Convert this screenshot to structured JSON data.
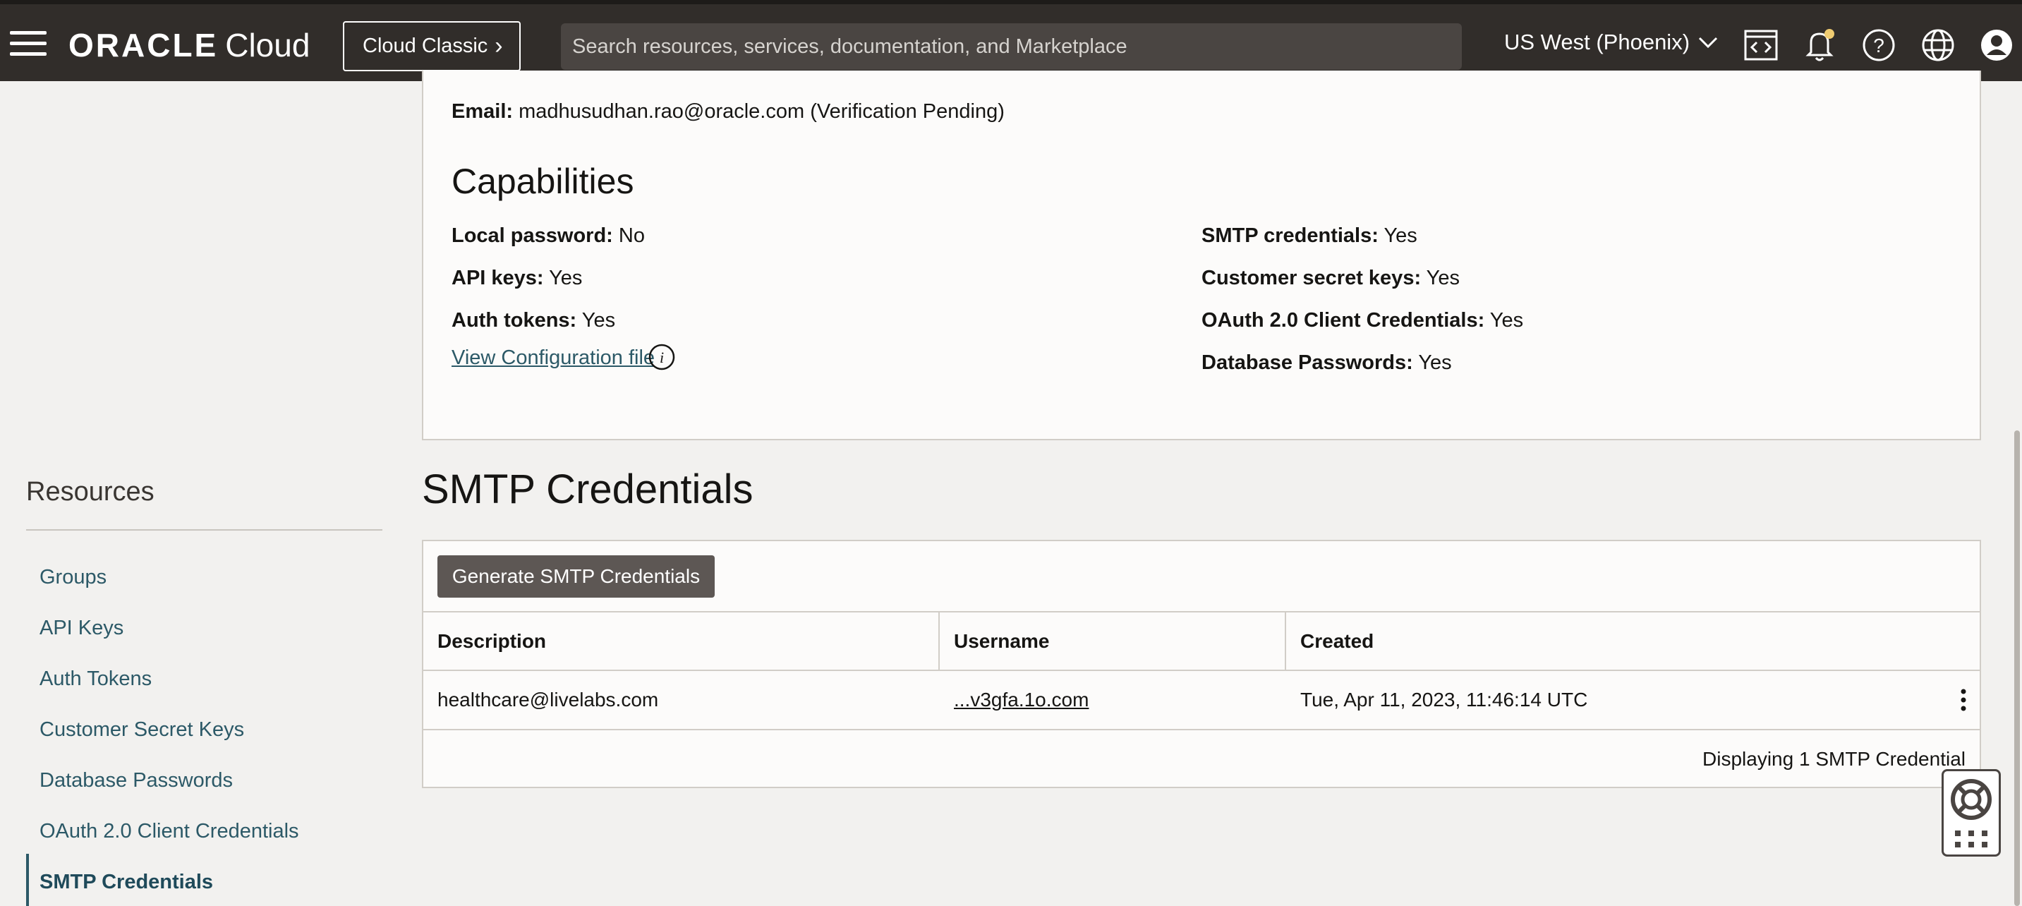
{
  "topbar": {
    "brand_oracle": "ORACLE",
    "brand_cloud": "Cloud",
    "classic_label": "Cloud Classic",
    "search_placeholder": "Search resources, services, documentation, and Marketplace",
    "region": "US West (Phoenix)",
    "icons": [
      "menu-icon",
      "code-editor-icon",
      "bell-icon",
      "help-icon",
      "globe-icon",
      "user-icon"
    ]
  },
  "user": {
    "email_label": "Email:",
    "email_value": "madhusudhan.rao@oracle.com (Verification Pending)"
  },
  "capabilities": {
    "title": "Capabilities",
    "left": [
      {
        "label": "Local password:",
        "value": "No"
      },
      {
        "label": "API keys:",
        "value": "Yes"
      },
      {
        "label": "Auth tokens:",
        "value": "Yes"
      }
    ],
    "right": [
      {
        "label": "SMTP credentials:",
        "value": "Yes"
      },
      {
        "label": "Customer secret keys:",
        "value": "Yes"
      },
      {
        "label": "OAuth 2.0 Client Credentials:",
        "value": "Yes"
      },
      {
        "label": "Database Passwords:",
        "value": "Yes"
      }
    ],
    "config_link": "View Configuration file"
  },
  "resources": {
    "title": "Resources",
    "items": [
      {
        "label": "Groups"
      },
      {
        "label": "API Keys"
      },
      {
        "label": "Auth Tokens"
      },
      {
        "label": "Customer Secret Keys"
      },
      {
        "label": "Database Passwords"
      },
      {
        "label": "OAuth 2.0 Client Credentials"
      },
      {
        "label": "SMTP Credentials",
        "active": true
      }
    ]
  },
  "smtp": {
    "title": "SMTP Credentials",
    "generate_label": "Generate SMTP Credentials",
    "columns": [
      "Description",
      "Username",
      "Created"
    ],
    "rows": [
      {
        "description": "healthcare@livelabs.com",
        "username": "...v3gfa.1o.com",
        "created": "Tue, Apr 11, 2023, 11:46:14 UTC"
      }
    ],
    "footer": "Displaying 1 SMTP Credential"
  },
  "colors": {
    "topbar": "#312d2a",
    "link": "#2c5967",
    "button": "#5d5754",
    "notification_dot": "#f0cc71"
  }
}
